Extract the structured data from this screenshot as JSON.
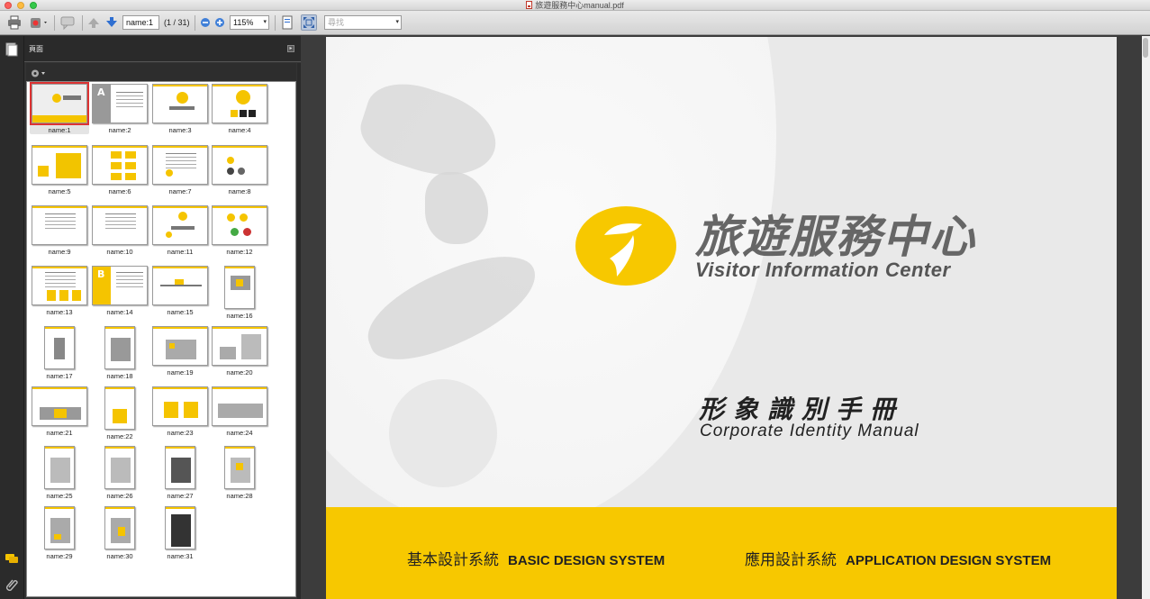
{
  "window": {
    "title": "旅遊服務中心manual.pdf"
  },
  "toolbar": {
    "page_input": "name:1",
    "page_count": "(1 / 31)",
    "zoom": "115%",
    "search_placeholder": "尋找"
  },
  "sidebar": {
    "title": "頁面",
    "thumbnails": [
      {
        "label": "name:1"
      },
      {
        "label": "name:2"
      },
      {
        "label": "name:3"
      },
      {
        "label": "name:4"
      },
      {
        "label": "name:5"
      },
      {
        "label": "name:6"
      },
      {
        "label": "name:7"
      },
      {
        "label": "name:8"
      },
      {
        "label": "name:9"
      },
      {
        "label": "name:10"
      },
      {
        "label": "name:11"
      },
      {
        "label": "name:12"
      },
      {
        "label": "name:13"
      },
      {
        "label": "name:14"
      },
      {
        "label": "name:15"
      },
      {
        "label": "name:16"
      },
      {
        "label": "name:17"
      },
      {
        "label": "name:18"
      },
      {
        "label": "name:19"
      },
      {
        "label": "name:20"
      },
      {
        "label": "name:21"
      },
      {
        "label": "name:22"
      },
      {
        "label": "name:23"
      },
      {
        "label": "name:24"
      },
      {
        "label": "name:25"
      },
      {
        "label": "name:26"
      },
      {
        "label": "name:27"
      },
      {
        "label": "name:28"
      },
      {
        "label": "name:29"
      },
      {
        "label": "name:30"
      },
      {
        "label": "name:31"
      }
    ],
    "thumb_letters": {
      "p2": "A",
      "p14": "B"
    }
  },
  "document": {
    "brand_cn": "旅遊服務中心",
    "brand_en": "Visitor Information Center",
    "manual_cn": "形象識別手冊",
    "manual_en": "Corporate Identity Manual",
    "basic_cn": "基本設計系統",
    "basic_en": "BASIC DESIGN SYSTEM",
    "app_cn": "應用設計系統",
    "app_en": "APPLICATION DESIGN SYSTEM"
  },
  "colors": {
    "brand_yellow": "#f7c800",
    "selection_red": "#dd3333"
  }
}
